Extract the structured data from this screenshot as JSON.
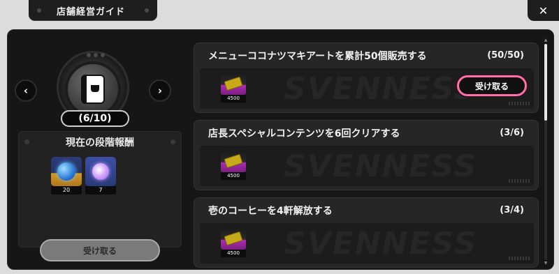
{
  "window": {
    "title": "店舗経営ガイド",
    "close_label": "✕"
  },
  "stage": {
    "progress": "(6/10)",
    "icon": "notebook-coffee-icon",
    "prev_label": "‹",
    "next_label": "›"
  },
  "stage_reward": {
    "title": "現在の段階報酬",
    "items": [
      {
        "icon": "blue-orb-icon",
        "count": "20"
      },
      {
        "icon": "crystal-gem-icon",
        "count": "7"
      }
    ],
    "claim_label": "受け取る"
  },
  "missions": [
    {
      "title": "メニューココナツマキアートを累計50個販売する",
      "progress": "(50/50)",
      "reward_icon": "ticket-card-icon",
      "reward_count": "4500",
      "claimable": true,
      "claim_label": "受け取る"
    },
    {
      "title": "店長スペシャルコンテンツを6回クリアする",
      "progress": "(3/6)",
      "reward_icon": "ticket-card-icon",
      "reward_count": "4500",
      "claimable": false
    },
    {
      "title": "壱のコーヒーを4軒解放する",
      "progress": "(3/4)",
      "reward_icon": "ticket-card-icon",
      "reward_count": "4500",
      "claimable": false
    }
  ],
  "watermark": "SVENNESS",
  "colors": {
    "accent_pink": "#ff6fa8",
    "panel_bg": "#161616",
    "card_bg": "#262626"
  }
}
